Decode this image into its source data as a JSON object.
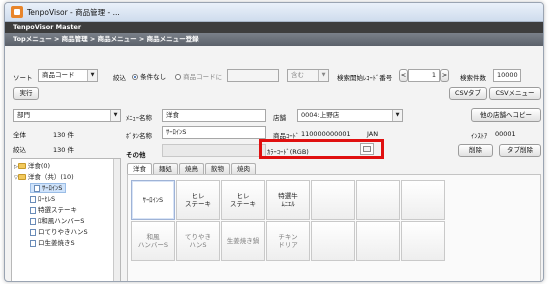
{
  "window": {
    "title": "TenpoVisor - 商品管理 - ..."
  },
  "header": {
    "app_name": "TenpoVisor Master"
  },
  "breadcrumb": {
    "text": "Topメニュー > 商品管理 > 商品メニュー > 商品メニュー登録"
  },
  "toolbar": {
    "sort_label": "ソート",
    "sort_value": "商品コード",
    "narrow_label": "絞込",
    "radio_none": "条件なし",
    "radio_code": "商品コードに",
    "match_value": "含む",
    "search_start_label": "検索開始ﾚｺｰﾄﾞ番号",
    "record_value": "1",
    "count_label": "検索件数",
    "count_value": "10000",
    "execute": "実行",
    "csv_tab": "CSVタブ",
    "csv_menu": "CSVメニュー"
  },
  "left": {
    "dept_value": "部門",
    "total_label": "全体",
    "total_value": "130 件",
    "filtered_label": "絞込",
    "filtered_value": "130 件",
    "tree": [
      {
        "label": "洋食(0)",
        "type": "folder",
        "indent": 0
      },
      {
        "label": "洋食（共）(10)",
        "type": "folder",
        "indent": 0
      },
      {
        "label": "ｻｰﾛｲﾝS",
        "type": "doc",
        "indent": 1,
        "selected": true
      },
      {
        "label": "ﾛｰﾋﾚS",
        "type": "doc",
        "indent": 1
      },
      {
        "label": "特選ステーキ",
        "type": "doc",
        "indent": 1
      },
      {
        "label": "ﾛ和風ハンバーS",
        "type": "doc",
        "indent": 1
      },
      {
        "label": "ロてりやきハンS",
        "type": "doc",
        "indent": 1
      },
      {
        "label": "ロ生姜焼きS",
        "type": "doc",
        "indent": 1
      }
    ]
  },
  "form": {
    "menu_name_label": "ﾒﾆｭｰ名称",
    "menu_name_value": "洋食",
    "button_name_label": "ﾎﾞﾀﾝ名称",
    "button_name_value": "ｻｰﾛｲﾝS",
    "other_label": "その他",
    "store_label": "店舗",
    "store_value": "0004:上野店",
    "other_store_copy": "他の店舗へコピー",
    "product_code_label": "商品ｺｰﾄﾞ",
    "product_code_value": "110000000001",
    "jan_label": "JAN",
    "instore_label": "ｲﾝｽﾄｱ",
    "instore_value": "00001",
    "color_label": "ｶﾗｰｺｰﾄﾞ(RGB)",
    "delete": "削除",
    "tab_delete": "タブ削除"
  },
  "tabs": [
    "洋食",
    "麺処",
    "焼鳥",
    "飲物",
    "焼肉"
  ],
  "grid": {
    "rows": [
      [
        "ｻｰﾛｲﾝS",
        "ヒレ\nステーキ",
        "ヒレ\nステーキ",
        "特選牛\nﾑﾆｴﾙ",
        "",
        "",
        ""
      ],
      [
        "和風\nハンバーS",
        "てりやき\nハンS",
        "生姜焼き鍋",
        "チキン\nドリア",
        "",
        "",
        ""
      ]
    ]
  },
  "colors": {
    "highlight": "#e01010",
    "selection": "#cfe3fb"
  }
}
